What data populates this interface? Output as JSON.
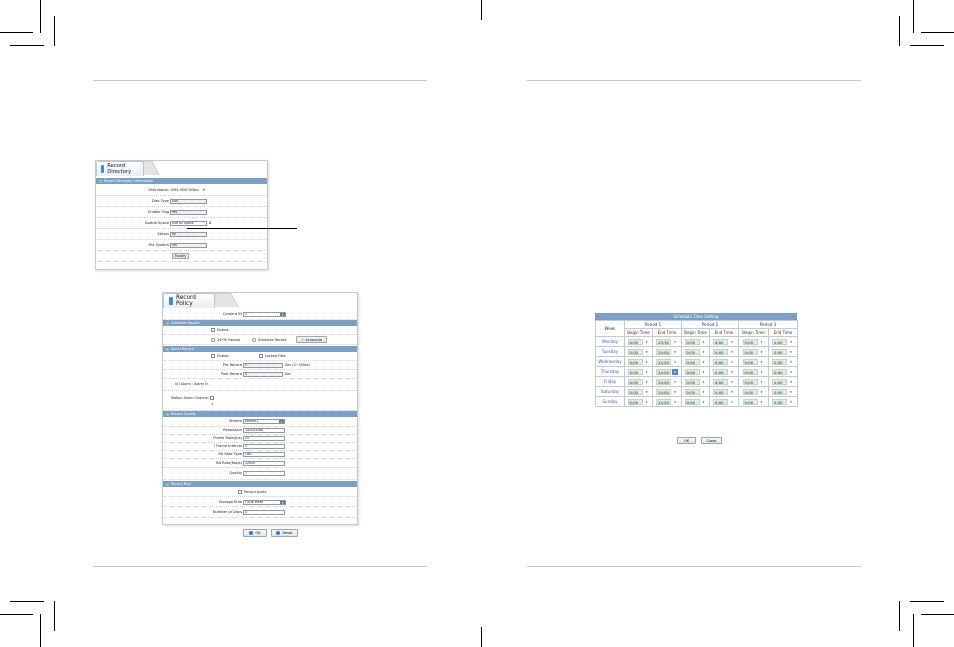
{
  "record_directory": {
    "tab_label": "Record Directory",
    "section": "Record Directory Information",
    "disk_name_label": "Disk Name:",
    "disk_name_value": "1962.9GB 5V6pu",
    "disk_type_label": "Disk Type",
    "disk_type_value": "SAS",
    "enable_flag_label": "Enable Flag",
    "enable_flag_value": "Yes",
    "usable_space_label": "Usable Space",
    "usable_space_value": "Use All Space",
    "usable_space_unit": "B",
    "status_label": "Status",
    "status_value": "ok",
    "file_system_label": "File System",
    "file_system_value": "ufs",
    "modify_button": "Modify"
  },
  "record_policy": {
    "tab_label": "Record Policy",
    "camera_id_label": "Camera ID",
    "camera_id_value": "1",
    "schedule_section": "Schedule Record",
    "enable_label": "Enable",
    "record_24x7_label": "24*7h Record",
    "schedule_record_label": "Schedule Record",
    "schedule_button": "Schedule",
    "alarm_section": "Alarm Record",
    "alarm_enable_label": "Enable",
    "locked_files_label": "Locked Files",
    "pre_record_label": "Pre Record",
    "pre_record_value": "5",
    "pre_record_unit": "Sec (0~30Sec)",
    "post_record_label": "Post Record",
    "post_record_value": "5",
    "post_record_unit": "Sec",
    "io_alarm_label": "I/O Alarm : Alarm In",
    "motion_alarm_label": "Motion Alarm Channel",
    "motion_alarm_sub": "1",
    "quality_section": "Record Quality",
    "stream_label": "Stream",
    "stream_value": "stream1",
    "resolution_label": "Resolution",
    "resolution_value": "1920X1080",
    "frame_rate_label": "Frame Rate(fps)",
    "frame_rate_value": "25",
    "iframe_label": "I Frame Interval",
    "iframe_value": "5",
    "bitrate_type_label": "Bit Rate Type",
    "bitrate_type_value": "CBR",
    "bitrate_label": "Bit Rate(Kbps)",
    "bitrate_value": "12000",
    "quality_label": "Quality",
    "quality_value": "7",
    "rule_section": "Record Rule",
    "record_audio_label": "Record Audio",
    "storage_rule_label": "Storage Rule",
    "storage_rule_value": "Cycle Write",
    "number_days_label": "Number of Days",
    "number_days_value": "0",
    "ok_button": "OK",
    "reset_button": "Reset"
  },
  "schedule": {
    "title": "Schedule Time Setting",
    "week_header": "Week",
    "periods": [
      "Period 1",
      "Period 2",
      "Period 3"
    ],
    "begin_header": "Begin Time",
    "end_header": "End Time",
    "rows": [
      {
        "day": "Monday",
        "p1b": "0:00",
        "p1e": "23:30",
        "p2b": "0:00",
        "p2e": "0:00",
        "p3b": "0:00",
        "p3e": "0:00"
      },
      {
        "day": "Tuesday",
        "p1b": "0:00",
        "p1e": "24:00",
        "p2b": "0:00",
        "p2e": "0:00",
        "p3b": "0:00",
        "p3e": "0:00"
      },
      {
        "day": "Wednesday",
        "p1b": "0:00",
        "p1e": "24:00",
        "p2b": "0:00",
        "p2e": "0:00",
        "p3b": "0:00",
        "p3e": "0:00"
      },
      {
        "day": "Thursday",
        "p1b": "0:00",
        "p1e": "24:00",
        "p2b": "0:00",
        "p2e": "0:00",
        "p3b": "0:00",
        "p3e": "0:00"
      },
      {
        "day": "Friday",
        "p1b": "0:00",
        "p1e": "24:00",
        "p2b": "0:00",
        "p2e": "0:00",
        "p3b": "0:00",
        "p3e": "0:00"
      },
      {
        "day": "Saturday",
        "p1b": "0:00",
        "p1e": "24:00",
        "p2b": "0:00",
        "p2e": "0:00",
        "p3b": "0:00",
        "p3e": "0:00"
      },
      {
        "day": "Sunday",
        "p1b": "0:00",
        "p1e": "24:00",
        "p2b": "0:00",
        "p2e": "0:00",
        "p3b": "0:00",
        "p3e": "0:00"
      }
    ],
    "ok_button": "OK",
    "close_button": "Close"
  }
}
